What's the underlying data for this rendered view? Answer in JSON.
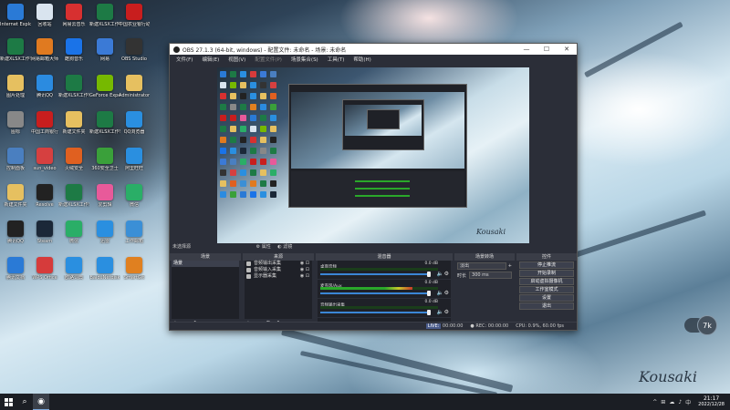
{
  "desktop": {
    "icons": [
      {
        "label": "Internet Explorer",
        "color": "#2a7ad6"
      },
      {
        "label": "回收站",
        "color": "#d9e4ef"
      },
      {
        "label": "网易云音乐",
        "color": "#d73030"
      },
      {
        "label": "新建XLSX工作表",
        "color": "#1d7a45"
      },
      {
        "label": "中国农业银行助手",
        "color": "#c81e1e"
      },
      {
        "label": "新建XLSX工作表",
        "color": "#1d7a45"
      },
      {
        "label": "网易邮箱大师",
        "color": "#e07a20"
      },
      {
        "label": "酷狗音乐",
        "color": "#1a73e8"
      },
      {
        "label": "网易",
        "color": "#3b7ad6"
      },
      {
        "label": "OBS Studio",
        "color": "#333333"
      },
      {
        "label": "图片处理",
        "color": "#e6c060"
      },
      {
        "label": "腾讯QQ",
        "color": "#2b8be0"
      },
      {
        "label": "新建XLSX工作表",
        "color": "#1d7a45"
      },
      {
        "label": "GeForce Experience",
        "color": "#76b900"
      },
      {
        "label": "Administrator",
        "color": "#e6c060"
      },
      {
        "label": "图标",
        "color": "#888888"
      },
      {
        "label": "中国工商银行",
        "color": "#c81e1e"
      },
      {
        "label": "新建文件夹",
        "color": "#e6c060"
      },
      {
        "label": "新建XLSX工作表",
        "color": "#1d7a45"
      },
      {
        "label": "QQ浏览器",
        "color": "#2a8fe0"
      },
      {
        "label": "控制面板",
        "color": "#4a7fc0"
      },
      {
        "label": "sun_video",
        "color": "#d64040"
      },
      {
        "label": "火绒安全",
        "color": "#e06020"
      },
      {
        "label": "360安全卫士",
        "color": "#3aa03a"
      },
      {
        "label": "阿里旺旺",
        "color": "#2a8fe0"
      },
      {
        "label": "新建文件夹",
        "color": "#e6c060"
      },
      {
        "label": "Resolve",
        "color": "#222222"
      },
      {
        "label": "新建XLSX工作表",
        "color": "#1d7a45"
      },
      {
        "label": "爱剪辑",
        "color": "#e85a9a"
      },
      {
        "label": "微信",
        "color": "#2aae67"
      },
      {
        "label": "腾讯QQ",
        "color": "#222222"
      },
      {
        "label": "Steam",
        "color": "#1b2838"
      },
      {
        "label": "微信",
        "color": "#2aae67"
      },
      {
        "label": "迅雷",
        "color": "#2a8fe0"
      },
      {
        "label": "工作邮箱",
        "color": "#3b8fd6"
      },
      {
        "label": "腾讯文档",
        "color": "#2a7ad6"
      },
      {
        "label": "WPS Office",
        "color": "#d63b3b"
      },
      {
        "label": "欧路词典",
        "color": "#2a8fe0"
      },
      {
        "label": "BaiduNetdisk",
        "color": "#2a8fe0"
      },
      {
        "label": "SmartGit",
        "color": "#e08020"
      }
    ],
    "signature": "Kousaki"
  },
  "obs": {
    "title": "OBS 27.1.3 (64-bit, windows) - 配置文件: 未命名 - 场景: 未命名",
    "window_buttons": [
      "—",
      "☐",
      "✕"
    ],
    "menu": [
      "文件(F)",
      "编辑(E)",
      "视图(V)",
      "配置文件(P)",
      "场景集合(S)",
      "工具(T)",
      "帮助(H)"
    ],
    "preview_signature": "Kousaki",
    "no_source_text": "未选择源",
    "props_label": "属性",
    "filters_label": "滤镜",
    "docks": {
      "scenes": {
        "title": "场景",
        "items": [
          "场景"
        ]
      },
      "sources": {
        "title": "来源",
        "items": [
          "音频输出采集",
          "音频输入采集",
          "显示器采集"
        ]
      },
      "mixer": {
        "title": "混音器",
        "channels": [
          {
            "name": "桌面音频",
            "db": "0.0 dB",
            "level": 0
          },
          {
            "name": "麦克风/Aux",
            "db": "0.0 dB",
            "level": 0.78
          },
          {
            "name": "音频输出采集",
            "db": "0.0 dB",
            "level": 0
          }
        ]
      },
      "transitions": {
        "title": "场景转场",
        "type": "淡出",
        "duration_label": "时长",
        "duration": "300 ms"
      },
      "controls": {
        "title": "控件",
        "buttons": [
          "停止推流",
          "开始录制",
          "启动虚拟摄像机",
          "工作室模式",
          "设置",
          "退出"
        ]
      }
    },
    "status": {
      "live": "LIVE:",
      "live_time": "00:00:00",
      "rec": "REC:",
      "rec_time": "00:00:00",
      "cpu": "CPU: 0.9%, 60.00 fps"
    }
  },
  "float_widget": {
    "label": "7k"
  },
  "taskbar": {
    "tray": [
      "^",
      "⊞",
      "☁",
      "♪",
      "中"
    ],
    "time": "21:17",
    "date": "2022/12/28"
  }
}
